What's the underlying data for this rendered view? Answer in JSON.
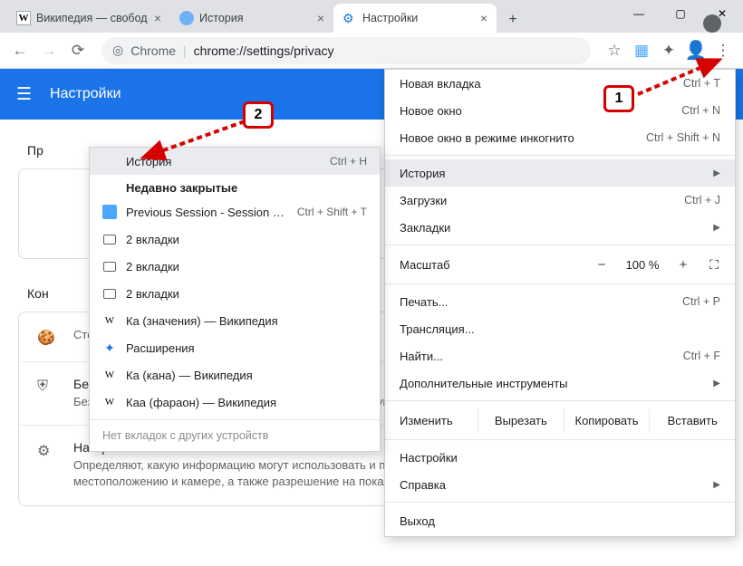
{
  "tabs": [
    {
      "label": "Википедия — свобод",
      "favicon": "W"
    },
    {
      "label": "История",
      "favicon": "clock"
    },
    {
      "label": "Настройки",
      "favicon": "gear"
    }
  ],
  "addressbar": {
    "scheme": "Chrome",
    "sep": "|",
    "path": "chrome://settings/privacy"
  },
  "settings_header": {
    "title": "Настройки"
  },
  "content": {
    "section1_title": "Пр",
    "section2_title": "Кон",
    "rows": [
      {
        "title": "",
        "sub": "Сторонние файлы cookie заблокированы в реж"
      },
      {
        "title": "Безопасность",
        "sub": "Безопасный просмотр (защита от опасных сайтов) и другие настройки безопасности"
      },
      {
        "title": "Настройки сайтов",
        "sub": "Определяют, какую информацию могут использовать и показывать сайты (например, есть ли у них доступ к местоположению и камере, а также разрешение на показ всплывающих окон и т. п.)"
      }
    ]
  },
  "menu": {
    "new_tab": {
      "label": "Новая вкладка",
      "shortcut": "Ctrl + T"
    },
    "new_window": {
      "label": "Новое окно",
      "shortcut": "Ctrl + N"
    },
    "incognito": {
      "label": "Новое окно в режиме инкогнито",
      "shortcut": "Ctrl + Shift + N"
    },
    "history": {
      "label": "История"
    },
    "downloads": {
      "label": "Загрузки",
      "shortcut": "Ctrl + J"
    },
    "bookmarks": {
      "label": "Закладки"
    },
    "zoom": {
      "label": "Масштаб",
      "value": "100 %"
    },
    "print": {
      "label": "Печать...",
      "shortcut": "Ctrl + P"
    },
    "cast": {
      "label": "Трансляция..."
    },
    "find": {
      "label": "Найти...",
      "shortcut": "Ctrl + F"
    },
    "more_tools": {
      "label": "Дополнительные инструменты"
    },
    "edit": {
      "label": "Изменить",
      "cut": "Вырезать",
      "copy": "Копировать",
      "paste": "Вставить"
    },
    "settings": {
      "label": "Настройки"
    },
    "help": {
      "label": "Справка"
    },
    "exit": {
      "label": "Выход"
    }
  },
  "submenu": {
    "history": {
      "label": "История",
      "shortcut": "Ctrl + H"
    },
    "recently_closed": "Недавно закрытые",
    "items": [
      {
        "icon": "sb",
        "label": "Previous Session - Session Buddy",
        "shortcut": "Ctrl + Shift + T"
      },
      {
        "icon": "tab",
        "label": "2 вкладки"
      },
      {
        "icon": "tab",
        "label": "2 вкладки"
      },
      {
        "icon": "tab",
        "label": "2 вкладки"
      },
      {
        "icon": "W",
        "label": "Ка (значения) — Википедия"
      },
      {
        "icon": "ext",
        "label": "Расширения"
      },
      {
        "icon": "W",
        "label": "Ка (кана) — Википедия"
      },
      {
        "icon": "W",
        "label": "Каа (фараон) — Википедия"
      }
    ],
    "footer": "Нет вкладок с других устройств"
  },
  "callouts": {
    "one": "1",
    "two": "2"
  }
}
